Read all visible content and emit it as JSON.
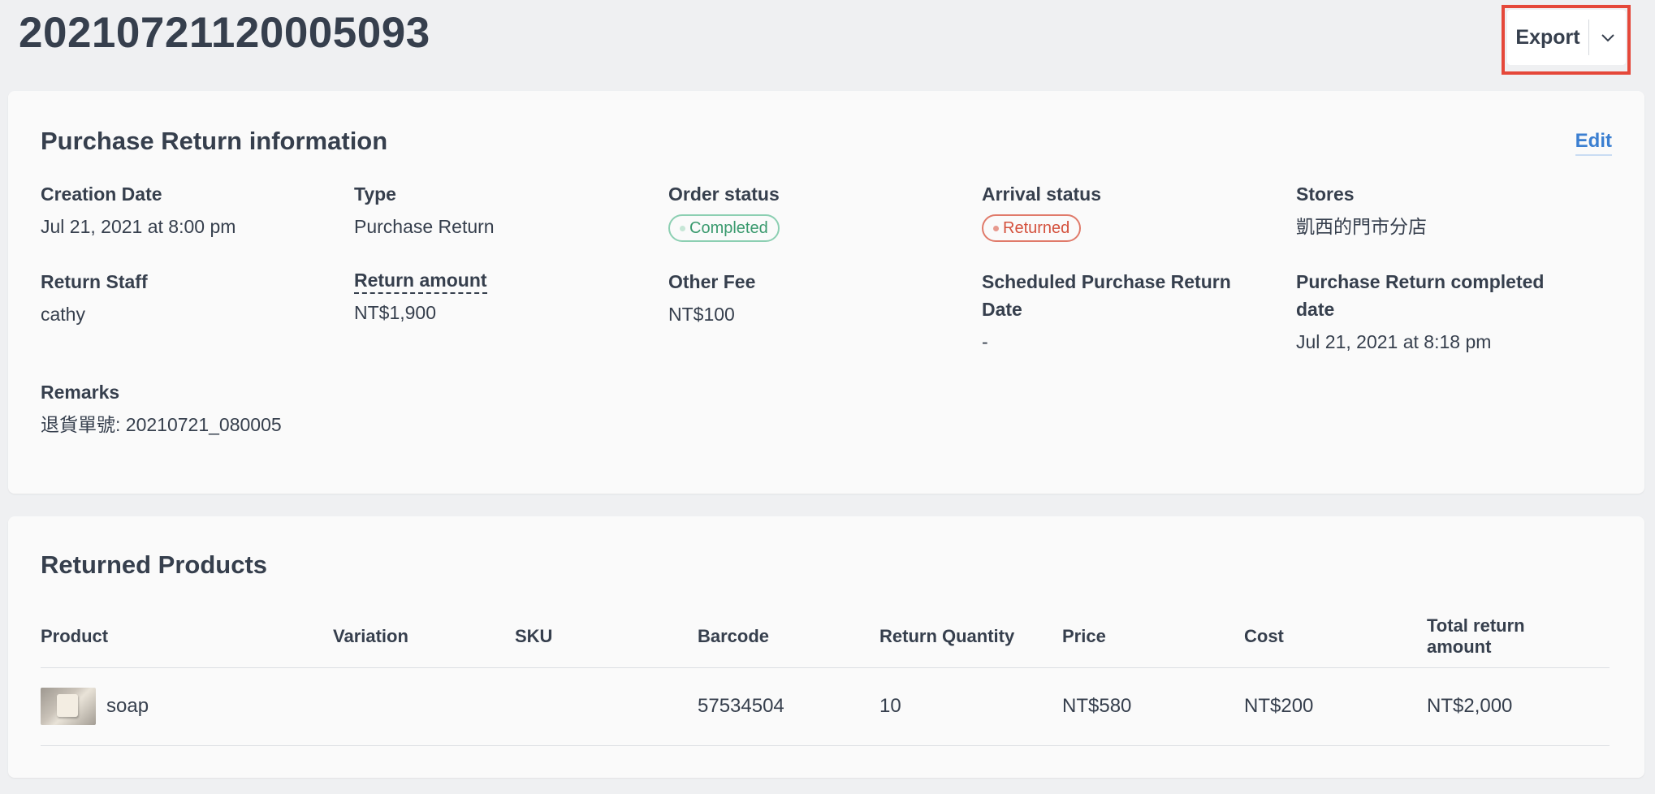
{
  "header": {
    "title": "20210721120005093",
    "export_label": "Export"
  },
  "info": {
    "title": "Purchase Return information",
    "edit_label": "Edit",
    "fields": {
      "creation_date": {
        "label": "Creation Date",
        "value": "Jul 21, 2021 at 8:00 pm"
      },
      "type": {
        "label": "Type",
        "value": "Purchase Return"
      },
      "order_status": {
        "label": "Order status",
        "value": "Completed"
      },
      "arrival_status": {
        "label": "Arrival status",
        "value": "Returned"
      },
      "stores": {
        "label": "Stores",
        "value": "凱西的門市分店"
      },
      "return_staff": {
        "label": "Return Staff",
        "value": "cathy"
      },
      "return_amount": {
        "label": "Return amount",
        "value": "NT$1,900"
      },
      "other_fee": {
        "label": "Other Fee",
        "value": "NT$100"
      },
      "scheduled_date": {
        "label": "Scheduled Purchase Return Date",
        "value": "-"
      },
      "completed_date": {
        "label": "Purchase Return completed date",
        "value": "Jul 21, 2021 at 8:18 pm"
      },
      "remarks": {
        "label": "Remarks",
        "value": "退貨單號: 20210721_080005"
      }
    },
    "colors": {
      "completed": "#3a9a6e",
      "returned": "#d4513d",
      "link": "#3b7fd1"
    }
  },
  "products": {
    "title": "Returned Products",
    "columns": [
      "Product",
      "Variation",
      "SKU",
      "Barcode",
      "Return Quantity",
      "Price",
      "Cost",
      "Total return amount"
    ],
    "rows": [
      {
        "product": "soap",
        "variation": "",
        "sku": "",
        "barcode": "57534504",
        "return_quantity": "10",
        "price": "NT$580",
        "cost": "NT$200",
        "total_return_amount": "NT$2,000"
      }
    ]
  },
  "icons": {
    "export_caret": "chevron-down-icon",
    "order_status_dot": "status-dot-icon",
    "product_image": "product-thumbnail"
  }
}
